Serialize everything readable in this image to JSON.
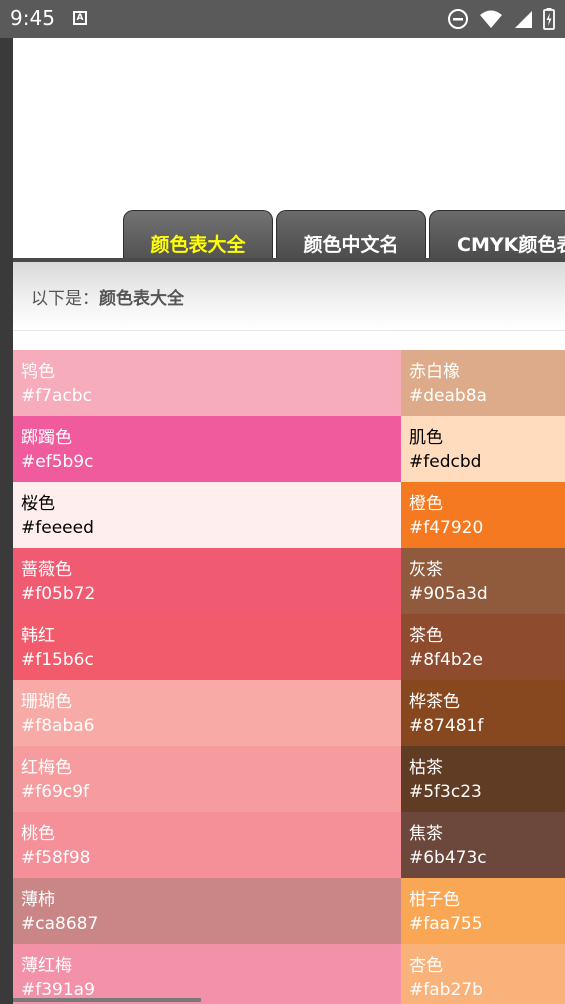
{
  "status_bar": {
    "time": "9:45",
    "app_icon_letter": "A"
  },
  "tabs": [
    {
      "label": "颜色表大全",
      "active": true
    },
    {
      "label": "颜色中文名",
      "active": false
    },
    {
      "label": "CMYK颜色表",
      "active": false
    }
  ],
  "subheader": {
    "prefix": "以下是：",
    "title": "颜色表大全"
  },
  "rows": [
    {
      "left": {
        "name": "鸨色",
        "hex": "#f7acbc",
        "text_color": "#ffffff"
      },
      "right": {
        "name": "赤白橡",
        "hex": "#deab8a",
        "text_color": "#ffffff"
      }
    },
    {
      "left": {
        "name": "踯躅色",
        "hex": "#ef5b9c",
        "text_color": "#ffffff"
      },
      "right": {
        "name": "肌色",
        "hex": "#fedcbd",
        "text_color": "#000000"
      }
    },
    {
      "left": {
        "name": "桜色",
        "hex": "#feeeed",
        "text_color": "#000000"
      },
      "right": {
        "name": "橙色",
        "hex": "#f47920",
        "text_color": "#ffffff"
      }
    },
    {
      "left": {
        "name": "蔷薇色",
        "hex": "#f05b72",
        "text_color": "#ffffff"
      },
      "right": {
        "name": "灰茶",
        "hex": "#905a3d",
        "text_color": "#ffffff"
      }
    },
    {
      "left": {
        "name": "韩红",
        "hex": "#f15b6c",
        "text_color": "#ffffff"
      },
      "right": {
        "name": "茶色",
        "hex": "#8f4b2e",
        "text_color": "#ffffff"
      }
    },
    {
      "left": {
        "name": "珊瑚色",
        "hex": "#f8aba6",
        "text_color": "#ffffff"
      },
      "right": {
        "name": "桦茶色",
        "hex": "#87481f",
        "text_color": "#ffffff"
      }
    },
    {
      "left": {
        "name": "红梅色",
        "hex": "#f69c9f",
        "text_color": "#ffffff"
      },
      "right": {
        "name": "枯茶",
        "hex": "#5f3c23",
        "text_color": "#ffffff"
      }
    },
    {
      "left": {
        "name": "桃色",
        "hex": "#f58f98",
        "text_color": "#ffffff"
      },
      "right": {
        "name": "焦茶",
        "hex": "#6b473c",
        "text_color": "#ffffff"
      }
    },
    {
      "left": {
        "name": "薄柿",
        "hex": "#ca8687",
        "text_color": "#ffffff"
      },
      "right": {
        "name": "柑子色",
        "hex": "#faa755",
        "text_color": "#ffffff"
      }
    },
    {
      "left": {
        "name": "薄红梅",
        "hex": "#f391a9",
        "text_color": "#ffffff"
      },
      "right": {
        "name": "杏色",
        "hex": "#fab27b",
        "text_color": "#ffffff"
      }
    }
  ]
}
